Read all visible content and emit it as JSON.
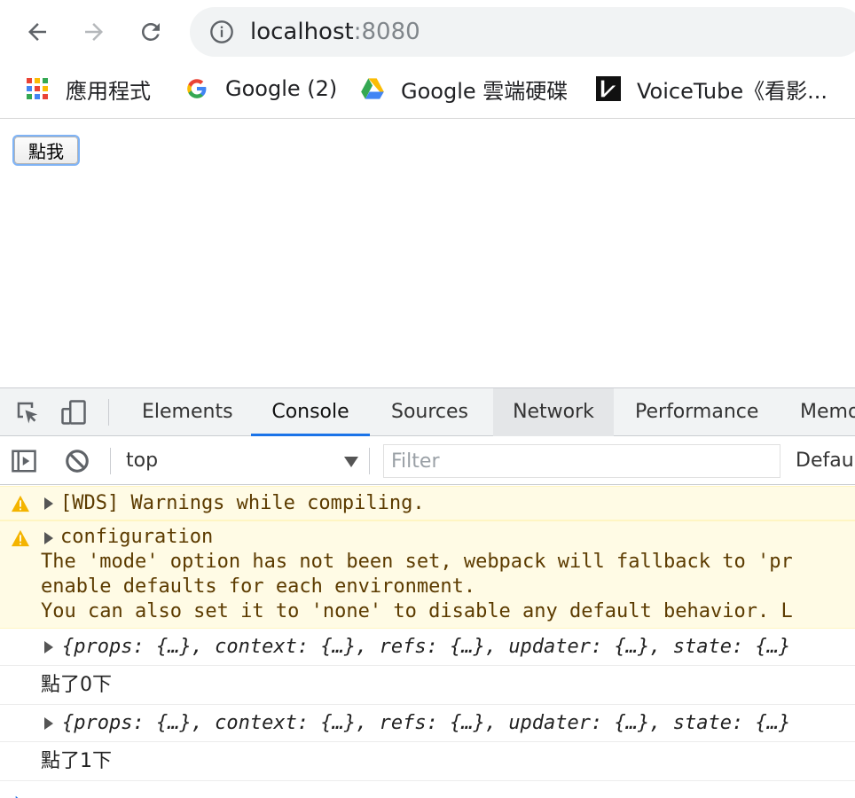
{
  "browser": {
    "url_host": "localhost",
    "url_port": ":8080",
    "bookmarks": [
      {
        "label": "應用程式",
        "icon": "apps-grid-icon"
      },
      {
        "label": "Google (2)",
        "icon": "google-g-icon"
      },
      {
        "label": "Google 雲端硬碟",
        "icon": "google-drive-icon"
      },
      {
        "label": "VoiceTube《看影...",
        "icon": "voicetube-icon"
      }
    ]
  },
  "page": {
    "button_label": "點我"
  },
  "devtools": {
    "tabs": [
      "Elements",
      "Console",
      "Sources",
      "Network",
      "Performance",
      "Memo"
    ],
    "active_tab": "Console",
    "context": "top",
    "filter_placeholder": "Filter",
    "levels_label": "Defaul",
    "messages": {
      "warn1": "[WDS] Warnings while compiling.",
      "warn2_title": "configuration",
      "warn2_line1": "The 'mode' option has not been set, webpack will fallback to 'pr",
      "warn2_line2": "enable defaults for each environment.",
      "warn2_line3": "You can also set it to 'none' to disable any default behavior. L",
      "obj1": "{props: {…}, context: {…}, refs: {…}, updater: {…}, state: {…}",
      "log1": "點了0下",
      "obj2": "{props: {…}, context: {…}, refs: {…}, updater: {…}, state: {…}",
      "log2": "點了1下"
    }
  },
  "colors": {
    "accent": "#1a73e8",
    "warning_bg": "#fffbe5",
    "warning_text": "#5c3b00"
  }
}
